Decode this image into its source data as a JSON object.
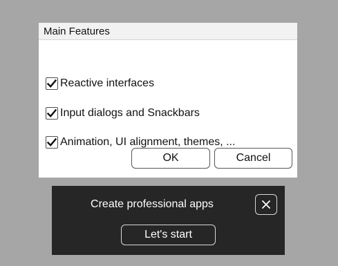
{
  "dialog": {
    "title": "Main Features",
    "features": [
      {
        "label": "Reactive interfaces",
        "checked": true
      },
      {
        "label": "Input dialogs and Snackbars",
        "checked": true
      },
      {
        "label": "Animation, UI alignment, themes, ...",
        "checked": true
      }
    ],
    "ok_label": "OK",
    "cancel_label": "Cancel"
  },
  "snackbar": {
    "message": "Create professional apps",
    "action_label": "Let's start",
    "close_icon": "close-icon"
  },
  "colors": {
    "background": "#a6a6a6",
    "dialog_bg": "#ffffff",
    "title_bar_bg": "#f2f2f2",
    "snackbar_bg": "#262626",
    "snackbar_text": "#ffffff"
  }
}
